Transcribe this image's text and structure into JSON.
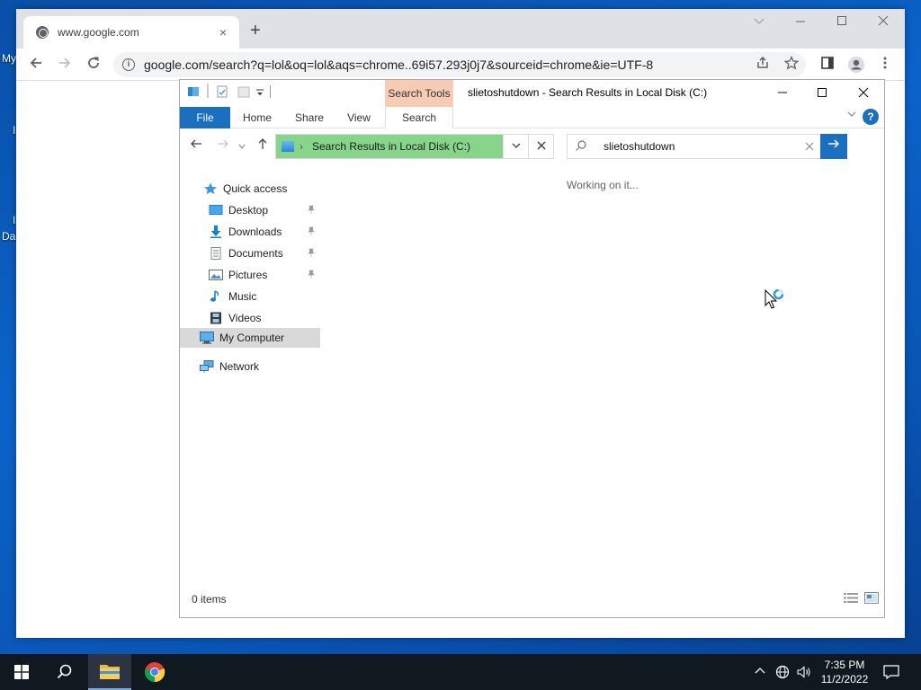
{
  "desktop": {
    "label_fragments": [
      "My",
      "I",
      "I",
      "Da"
    ]
  },
  "chrome": {
    "tab_title": "www.google.com",
    "tab_close": "×",
    "new_tab": "+",
    "url": "google.com/search?q=lol&oq=lol&aqs=chrome..69i57.293j0j7&sourceid=chrome&ie=UTF-8",
    "info_glyph": "i"
  },
  "explorer": {
    "contextual_tab": "Search Tools",
    "title": "slietoshutdown - Search Results in Local Disk (C:)",
    "ribbon_tabs": [
      "File",
      "Home",
      "Share",
      "View",
      "Search"
    ],
    "help_glyph": "?",
    "address": "Search Results in Local Disk (C:)",
    "search_query": "slietoshutdown",
    "nav": {
      "quick_access": "Quick access",
      "items": [
        "Desktop",
        "Downloads",
        "Documents",
        "Pictures",
        "Music",
        "Videos"
      ],
      "my_computer": "My Computer",
      "network": "Network"
    },
    "status_message": "Working on it...",
    "item_count": "0 items"
  },
  "taskbar": {
    "time": "7:35 PM",
    "date": "11/2/2022"
  }
}
